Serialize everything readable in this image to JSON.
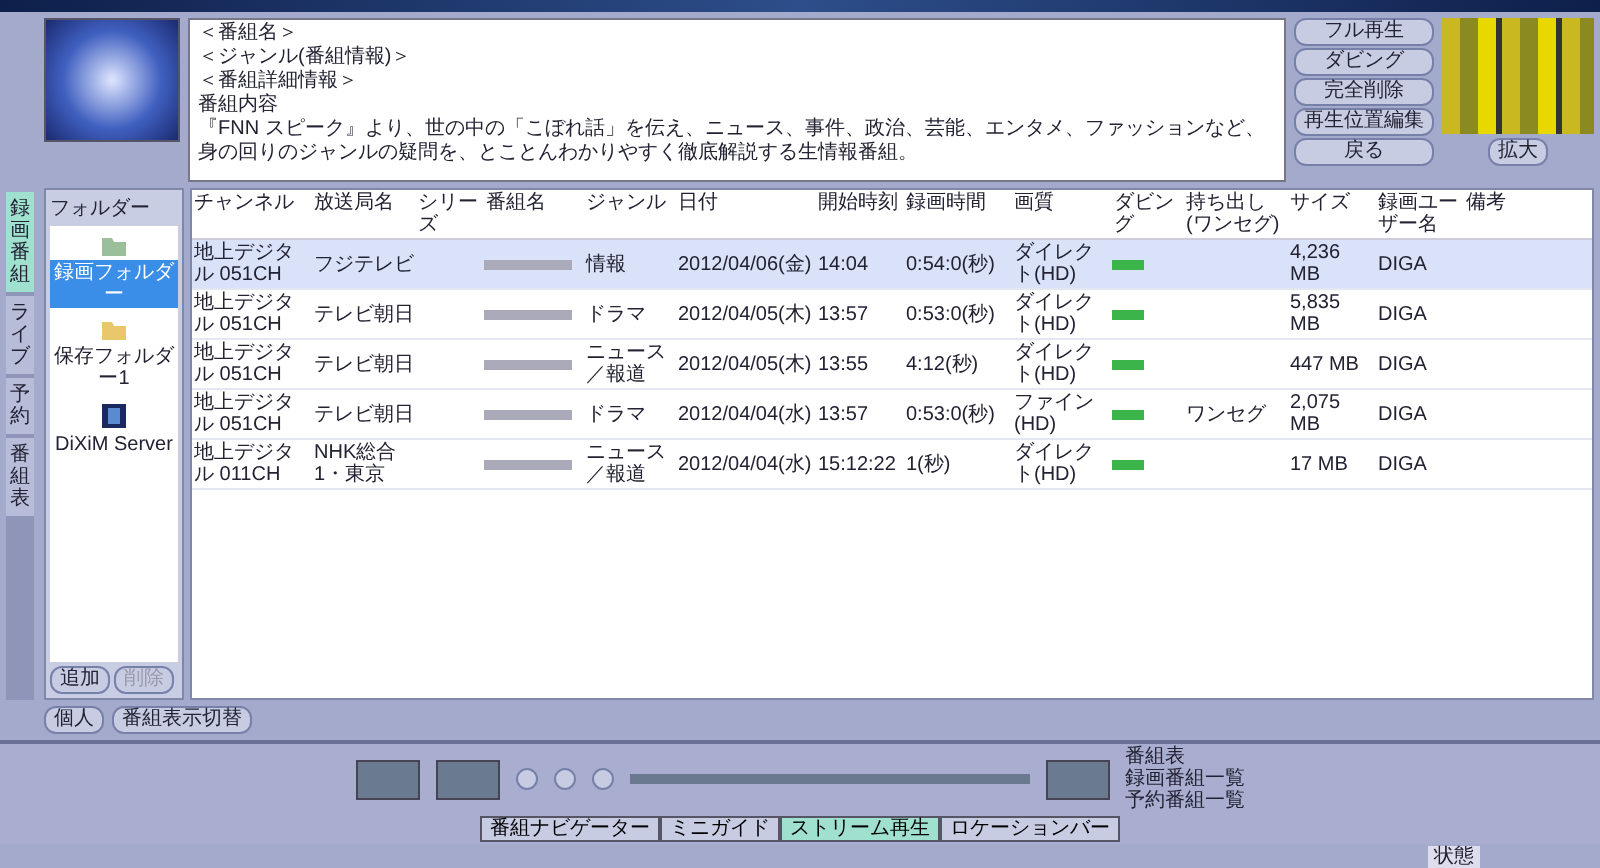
{
  "info": {
    "lines": [
      "＜番組名＞",
      "＜ジャンル(番組情報)＞",
      "＜番組詳細情報＞",
      "番組内容"
    ],
    "description": "『FNN スピーク』より、世の中の「こぼれ話」を伝え、ニュース、事件、政治、芸能、エンタメ、ファッションなど、身の回りのジャンルの疑問を、とことんわかりやすく徹底解説する生情報番組。"
  },
  "actions": [
    "フル再生",
    "ダビング",
    "完全削除",
    "再生位置編集",
    "戻る"
  ],
  "preview_button": "拡大",
  "side_tabs": [
    {
      "label": "録画番組",
      "selected": true
    },
    {
      "label": "ライブ",
      "selected": false
    },
    {
      "label": "予約",
      "selected": false
    },
    {
      "label": "番組表",
      "selected": false
    }
  ],
  "folders": {
    "title": "フォルダー",
    "items": [
      {
        "label": "録画フォルダー",
        "kind": "folder-green",
        "selected": true
      },
      {
        "label": "保存フォルダー1",
        "kind": "folder",
        "selected": false
      },
      {
        "label": "DiXiM Server",
        "kind": "server",
        "selected": false
      }
    ],
    "buttons": [
      {
        "label": "追加",
        "disabled": false
      },
      {
        "label": "削除",
        "disabled": true
      }
    ]
  },
  "bottom_left_buttons": [
    "個人",
    "番組表示切替"
  ],
  "table": {
    "columns": [
      "チャンネル",
      "放送局名",
      "シリーズ",
      "番組名",
      "ジャンル",
      "日付",
      "開始時刻",
      "録画時間",
      "画質",
      "ダビング",
      "持ち出し(ワンセグ)",
      "サイズ",
      "録画ユーザー名",
      "備考"
    ],
    "rows": [
      {
        "selected": true,
        "cells": [
          "地上デジタル 051CH",
          "フジテレビ",
          "",
          "",
          "情報",
          "2012/04/06(金)",
          "14:04",
          "0:54:0(秒)",
          "ダイレクト(HD)",
          "",
          "",
          "4,236 MB",
          "DIGA",
          ""
        ]
      },
      {
        "selected": false,
        "cells": [
          "地上デジタル 051CH",
          "テレビ朝日",
          "",
          "",
          "ドラマ",
          "2012/04/05(木)",
          "13:57",
          "0:53:0(秒)",
          "ダイレクト(HD)",
          "",
          "",
          "5,835 MB",
          "DIGA",
          ""
        ]
      },
      {
        "selected": false,
        "cells": [
          "地上デジタル 051CH",
          "テレビ朝日",
          "",
          "",
          "ニュース／報道",
          "2012/04/05(木)",
          "13:55",
          "4:12(秒)",
          "ダイレクト(HD)",
          "",
          "",
          "447 MB",
          "DIGA",
          ""
        ]
      },
      {
        "selected": false,
        "cells": [
          "地上デジタル 051CH",
          "テレビ朝日",
          "",
          "",
          "ドラマ",
          "2012/04/04(水)",
          "13:57",
          "0:53:0(秒)",
          "ファイン(HD)",
          "",
          "ワンセグ",
          "2,075 MB",
          "DIGA",
          ""
        ]
      },
      {
        "selected": false,
        "cells": [
          "地上デジタル 011CH",
          "NHK総合1・東京",
          "",
          "",
          "ニュース／報道",
          "2012/04/04(水)",
          "15:12:22",
          "1(秒)",
          "ダイレクト(HD)",
          "",
          "",
          "17 MB",
          "DIGA",
          ""
        ]
      }
    ]
  },
  "player": {
    "links": [
      "番組表",
      "録画番組一覧",
      "予約番組一覧"
    ],
    "tabs": [
      {
        "label": "番組ナビゲーター",
        "selected": false
      },
      {
        "label": "ミニガイド",
        "selected": false
      },
      {
        "label": "ストリーム再生",
        "selected": true
      },
      {
        "label": "ロケーションバー",
        "selected": false
      }
    ]
  },
  "status": {
    "label": "状態"
  }
}
